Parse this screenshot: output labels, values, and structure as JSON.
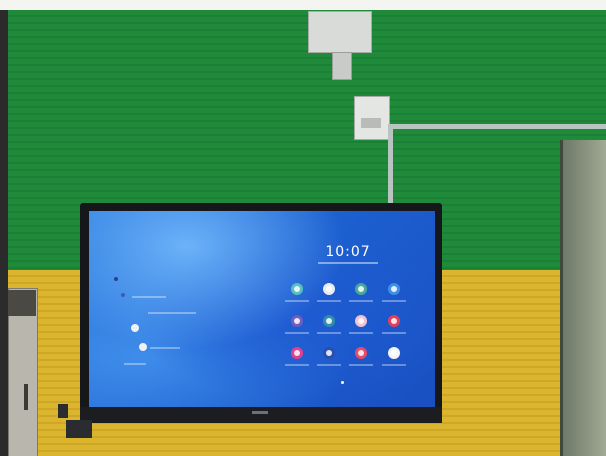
{
  "screen": {
    "clock": "10:07"
  },
  "colors": {
    "wall_green": "#1f8a3a",
    "wall_yellow": "#dcb52e",
    "screen_blue": "#1c5fd0",
    "frame_black": "#15171b"
  },
  "app_grid": [
    {
      "name": "teal-app-icon",
      "color": "#59c0c0"
    },
    {
      "name": "white-half-app-icon",
      "color": "#e7ecf3"
    },
    {
      "name": "green-app-icon",
      "color": "#4aa89a"
    },
    {
      "name": "blue-app-icon",
      "color": "#3f8ee8"
    },
    {
      "name": "purple-app-icon",
      "color": "#6d5fc0"
    },
    {
      "name": "teal-dark-app-icon",
      "color": "#2f8fa8"
    },
    {
      "name": "pink-light-app-icon",
      "color": "#f1c2d4"
    },
    {
      "name": "red-app-icon",
      "color": "#e0405a"
    },
    {
      "name": "magenta-app-icon",
      "color": "#e04090"
    },
    {
      "name": "navy-app-icon",
      "color": "#2a4fb0"
    },
    {
      "name": "red-pink-app-icon",
      "color": "#e84a6a"
    },
    {
      "name": "white-app-icon",
      "color": "#f2f4f7"
    }
  ]
}
